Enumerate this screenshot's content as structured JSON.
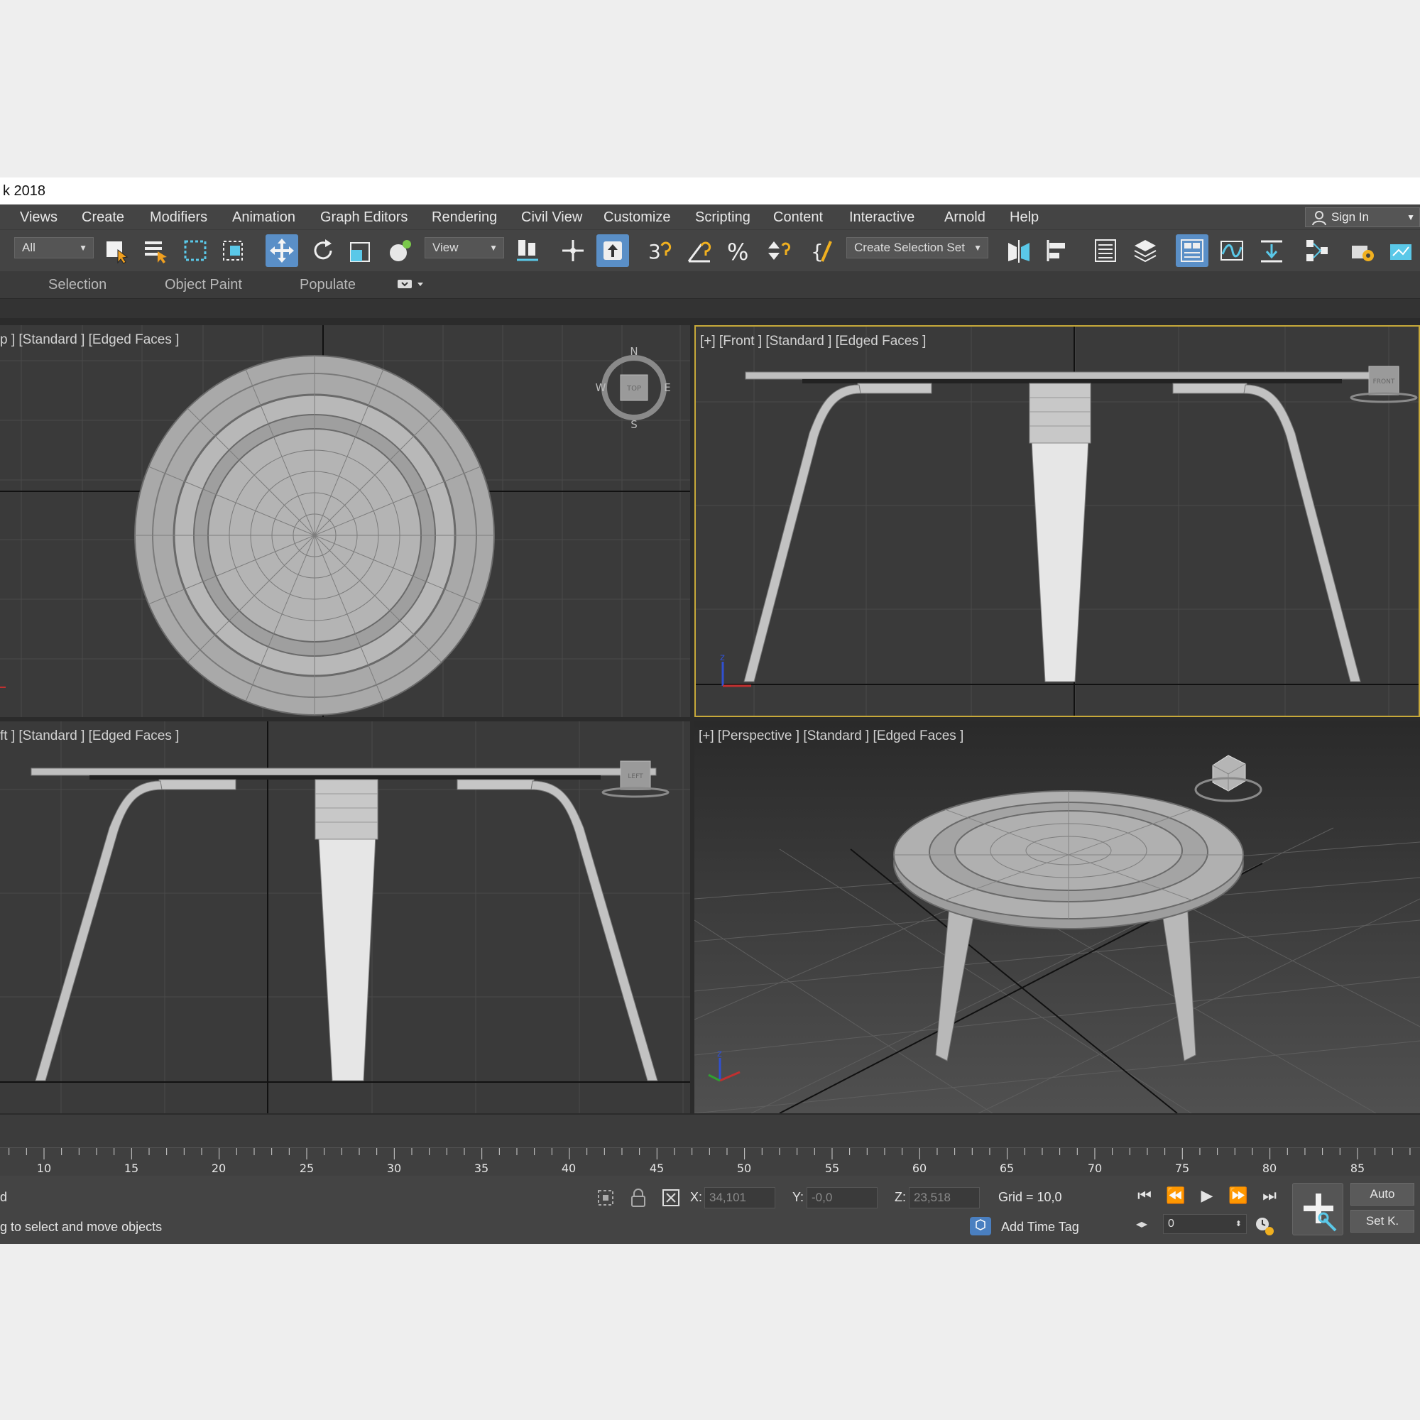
{
  "window": {
    "title": "k 2018"
  },
  "menu": {
    "items": [
      "Views",
      "Create",
      "Modifiers",
      "Animation",
      "Graph Editors",
      "Rendering",
      "Civil View",
      "Customize",
      "Scripting",
      "Content",
      "Interactive",
      "Arnold",
      "Help"
    ],
    "sign_in": "Sign In"
  },
  "toolbar": {
    "filter_value": "All",
    "ref_coord_value": "View",
    "selection_set_placeholder": "Create Selection Set",
    "icons": [
      "select-object-icon",
      "select-by-name-icon",
      "rectangular-selection-icon",
      "window-crossing-icon",
      "select-move-icon",
      "select-rotate-icon",
      "select-scale-icon",
      "place-icon",
      "mirror-icon",
      "select-manipulate-icon",
      "snap-3d-icon",
      "angle-snap-icon",
      "percent-snap-icon",
      "spinner-snap-icon",
      "edit-named-selection-icon",
      "mirror-tool-icon",
      "align-icon",
      "scene-explorer-icon",
      "layer-explorer-icon",
      "toggle-ribbon-icon",
      "curve-editor-icon",
      "schematic-view-icon",
      "material-editor-icon",
      "render-setup-icon",
      "render-frame-icon"
    ]
  },
  "ribbon": {
    "tabs": [
      "Selection",
      "Object Paint",
      "Populate"
    ]
  },
  "viewports": {
    "top_label": "p ] [Standard ] [Edged Faces ]",
    "front_label": "[+] [Front ] [Standard ] [Edged Faces ]",
    "left_label": "ft ] [Standard ] [Edged Faces ]",
    "persp_label": "[+] [Perspective ] [Standard ] [Edged Faces ]",
    "viewcube_top": "TOP",
    "viewcube_front": "FRONT",
    "viewcube_left": "LEFT",
    "compass": {
      "n": "N",
      "s": "S",
      "e": "E",
      "w": "W"
    },
    "axis": {
      "x": "x",
      "y": "y",
      "z": "z"
    }
  },
  "timeline": {
    "ticks": [
      "10",
      "15",
      "20",
      "25",
      "30",
      "35",
      "40",
      "45",
      "50",
      "55",
      "60",
      "65",
      "70",
      "75",
      "80",
      "85"
    ]
  },
  "status": {
    "selected_text": "d",
    "prompt": "g to select and move objects",
    "x_label": "X:",
    "x_value": "34,101",
    "y_label": "Y:",
    "y_value": "-0,0",
    "z_label": "Z:",
    "z_value": "23,518",
    "grid": "Grid = 10,0",
    "add_time_tag": "Add Time Tag",
    "frame_value": "0",
    "auto_label": "Auto",
    "setk_label": "Set K."
  }
}
